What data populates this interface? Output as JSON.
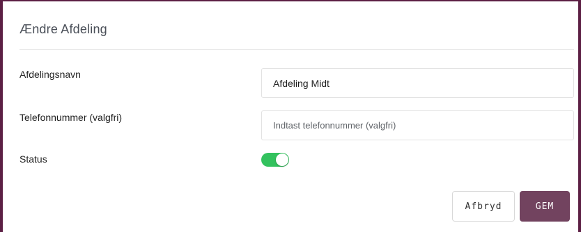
{
  "dialog": {
    "title": "Ændre Afdeling"
  },
  "form": {
    "department_name_label": "Afdelingsnavn",
    "department_name_value": "Afdeling Midt",
    "phone_label": "Telefonnummer (valgfri)",
    "phone_placeholder": "Indtast telefonnummer (valgfri)",
    "status_label": "Status",
    "status_enabled": true
  },
  "buttons": {
    "cancel_label": "Afbryd",
    "save_label": "GEM"
  },
  "colors": {
    "frame_border": "#5c1f44",
    "toggle_on": "#33c25e",
    "save_button": "#72435f"
  }
}
